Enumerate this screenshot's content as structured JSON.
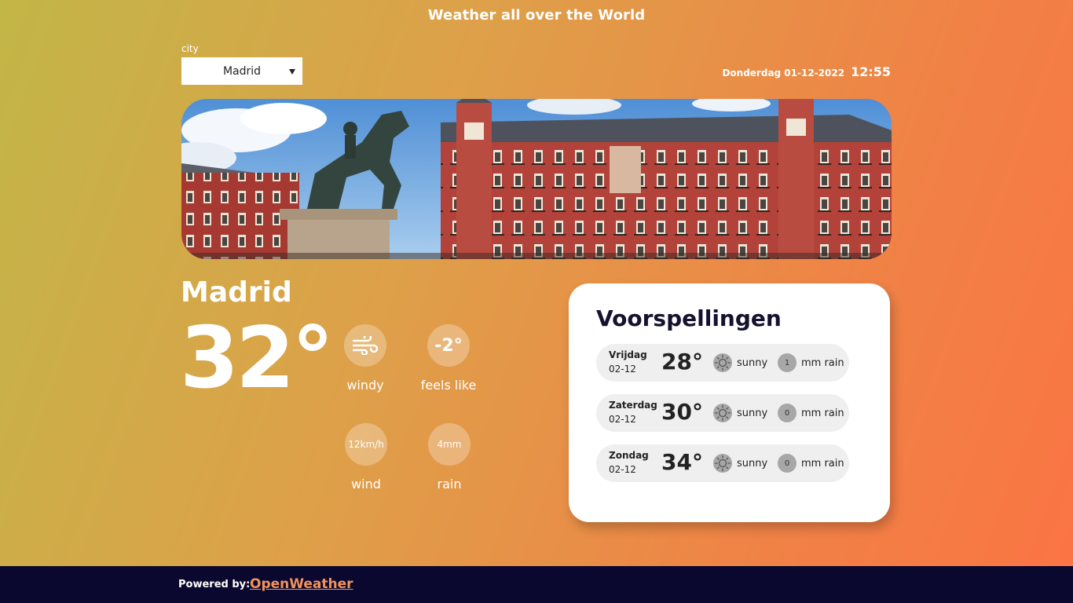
{
  "header": {
    "title": "Weather all over the World"
  },
  "city_select": {
    "label": "city",
    "selected": "Madrid"
  },
  "datetime": {
    "date": "Donderdag 01-12-2022",
    "time": "12:55"
  },
  "hero": {
    "image": "madrid-plaza-mayor-photo"
  },
  "current": {
    "city": "Madrid",
    "temperature": "32°",
    "stats": [
      {
        "value": "",
        "icon": "wind-icon",
        "label": "windy"
      },
      {
        "value": "-2°",
        "label": "feels like"
      },
      {
        "value": "12km/h",
        "label": "wind"
      },
      {
        "value": "4mm",
        "label": "rain"
      }
    ]
  },
  "forecast": {
    "title": "Voorspellingen",
    "days": [
      {
        "day": "Vrijdag",
        "date": "02-12",
        "temp": "28°",
        "icon": "sun-icon",
        "condition": "sunny",
        "rain_count": "1",
        "rain_label": "mm rain"
      },
      {
        "day": "Zaterdag",
        "date": "02-12",
        "temp": "30°",
        "icon": "sun-icon",
        "condition": "sunny",
        "rain_count": "0",
        "rain_label": "mm rain"
      },
      {
        "day": "Zondag",
        "date": "02-12",
        "temp": "34°",
        "icon": "sun-icon",
        "condition": "sunny",
        "rain_count": "0",
        "rain_label": "mm rain"
      }
    ]
  },
  "footer": {
    "powered_by": "Powered by:",
    "link": "OpenWeather"
  },
  "colors": {
    "gradient_start": "#c2b647",
    "gradient_end": "#fb7443",
    "footer_bg": "#0b0830",
    "link": "#f2945a",
    "card_text": "#14122e"
  }
}
